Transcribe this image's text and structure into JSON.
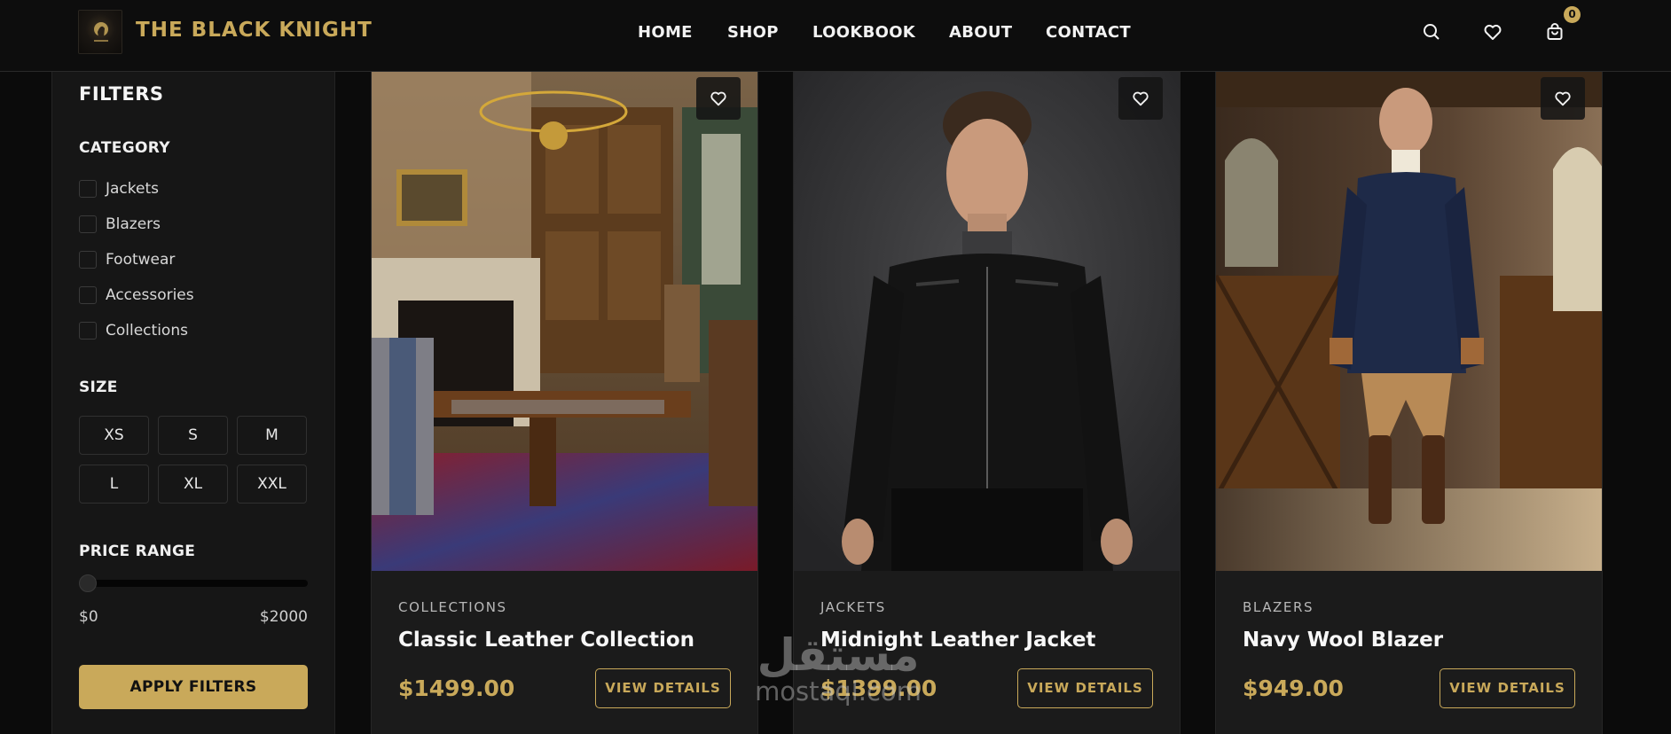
{
  "header": {
    "brand": "THE BLACK KNIGHT",
    "nav": [
      "HOME",
      "SHOP",
      "LOOKBOOK",
      "ABOUT",
      "CONTACT"
    ],
    "cart_count": "0",
    "icons": [
      "search-icon",
      "heart-icon",
      "shopping-bag-icon"
    ]
  },
  "filters": {
    "title": "FILTERS",
    "category_heading": "CATEGORY",
    "categories": [
      "Jackets",
      "Blazers",
      "Footwear",
      "Accessories",
      "Collections"
    ],
    "size_heading": "SIZE",
    "sizes": [
      "XS",
      "S",
      "M",
      "L",
      "XL",
      "XXL"
    ],
    "price_heading": "PRICE RANGE",
    "price_min": "$0",
    "price_max": "$2000",
    "slider_value": 0,
    "apply_label": "APPLY FILTERS"
  },
  "products": [
    {
      "category": "COLLECTIONS",
      "name": "Classic Leather Collection",
      "price": "$1499.00",
      "button": "VIEW DETAILS"
    },
    {
      "category": "JACKETS",
      "name": "Midnight Leather Jacket",
      "price": "$1399.00",
      "button": "VIEW DETAILS"
    },
    {
      "category": "BLAZERS",
      "name": "Navy Wool Blazer",
      "price": "$949.00",
      "button": "VIEW DETAILS"
    }
  ],
  "colors": {
    "accent": "#c9a95a",
    "background": "#0b0b0b",
    "panel": "#161616",
    "card": "#1b1b1b"
  },
  "watermark": {
    "arabic": "مستقل",
    "latin": "mostaql.com"
  }
}
